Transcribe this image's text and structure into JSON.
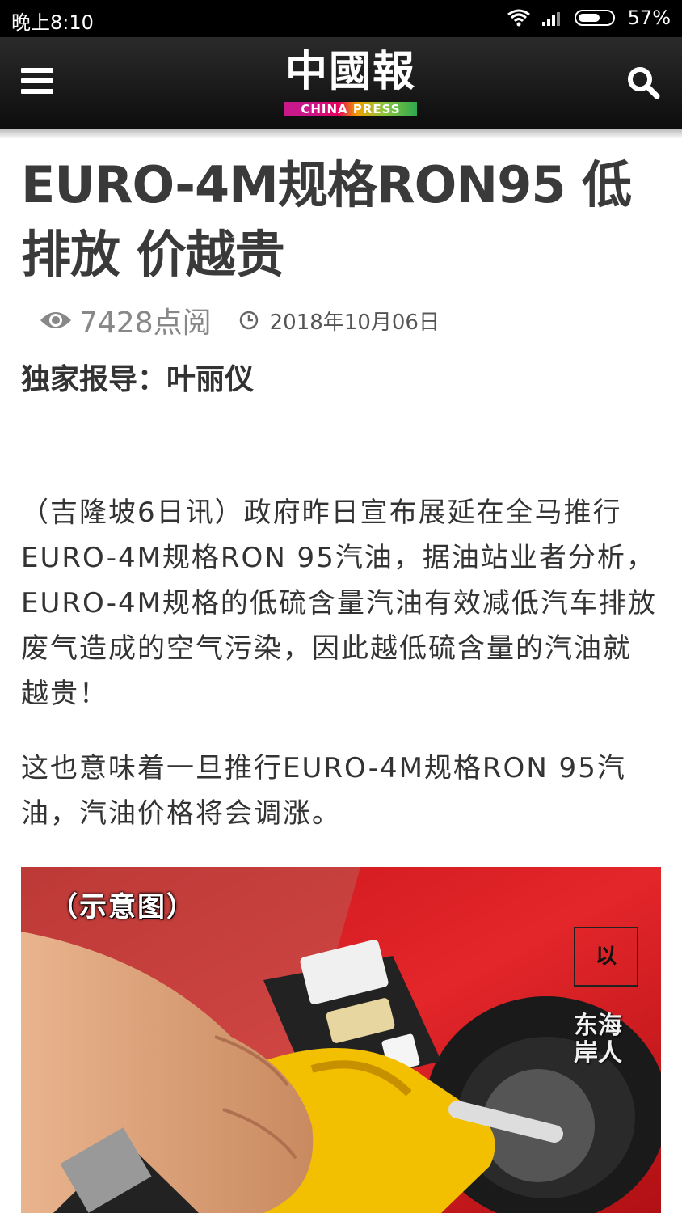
{
  "status": {
    "time": "晚上8:10",
    "battery": "57%"
  },
  "header": {
    "logo_cn": "中國報",
    "logo_en": "CHINA PRESS"
  },
  "article": {
    "title": "EURO-4M规格RON95 低排放 价越贵",
    "views": "7428点阅",
    "date": "2018年10月06日",
    "byline": "独家报导：叶丽仪",
    "paragraphs": [
      "（吉隆坡6日讯）政府昨日宣布展延在全马推行EURO-4M规格RON 95汽油，据油站业者分析，EURO-4M规格的低硫含量汽油有效减低汽车排放废气造成的空气污染，因此越低硫含量的汽油就越贵！",
      "这也意味着一旦推行EURO-4M规格RON 95汽油，汽油价格将会调涨。"
    ],
    "image": {
      "caption": "（示意图）",
      "watermark_logo": "以",
      "watermark_text": "东海岸人"
    }
  },
  "colors": {
    "header_bg": "#1a1a1a",
    "title": "#3a3a3a",
    "car_red": "#d51c1c",
    "nozzle_yellow": "#f2c000"
  }
}
